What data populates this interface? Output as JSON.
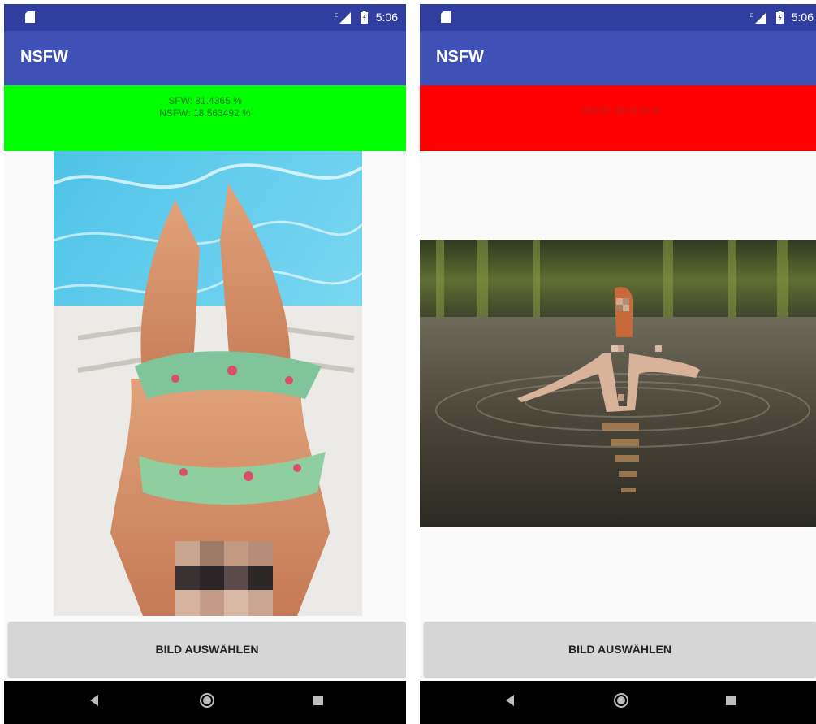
{
  "left_screen": {
    "status_bar": {
      "time": "5:06"
    },
    "app_bar": {
      "title": "NSFW"
    },
    "result": {
      "line1": "SFW: 81.4365 %",
      "line2": "NSFW: 18.563492 %",
      "color": "#00ff00"
    },
    "button": {
      "label": "BILD AUSWÄHLEN"
    }
  },
  "right_screen": {
    "status_bar": {
      "time": "5:06"
    },
    "app_bar": {
      "title": "NSFW"
    },
    "result": {
      "line1": "NSFW: 99.2144 %",
      "color": "#ff0000"
    },
    "button": {
      "label": "BILD AUSWÄHLEN"
    }
  },
  "icons": {
    "status": [
      "sd-card-icon",
      "signal-icon",
      "battery-icon"
    ],
    "nav": [
      "back-icon",
      "home-icon",
      "recents-icon"
    ]
  },
  "colors": {
    "status_bar": "#303f9f",
    "app_bar": "#3f51b5",
    "sfw_banner": "#00ff00",
    "nsfw_banner": "#ff0000",
    "button": "#d6d6d6",
    "nav_bar": "#000000"
  }
}
